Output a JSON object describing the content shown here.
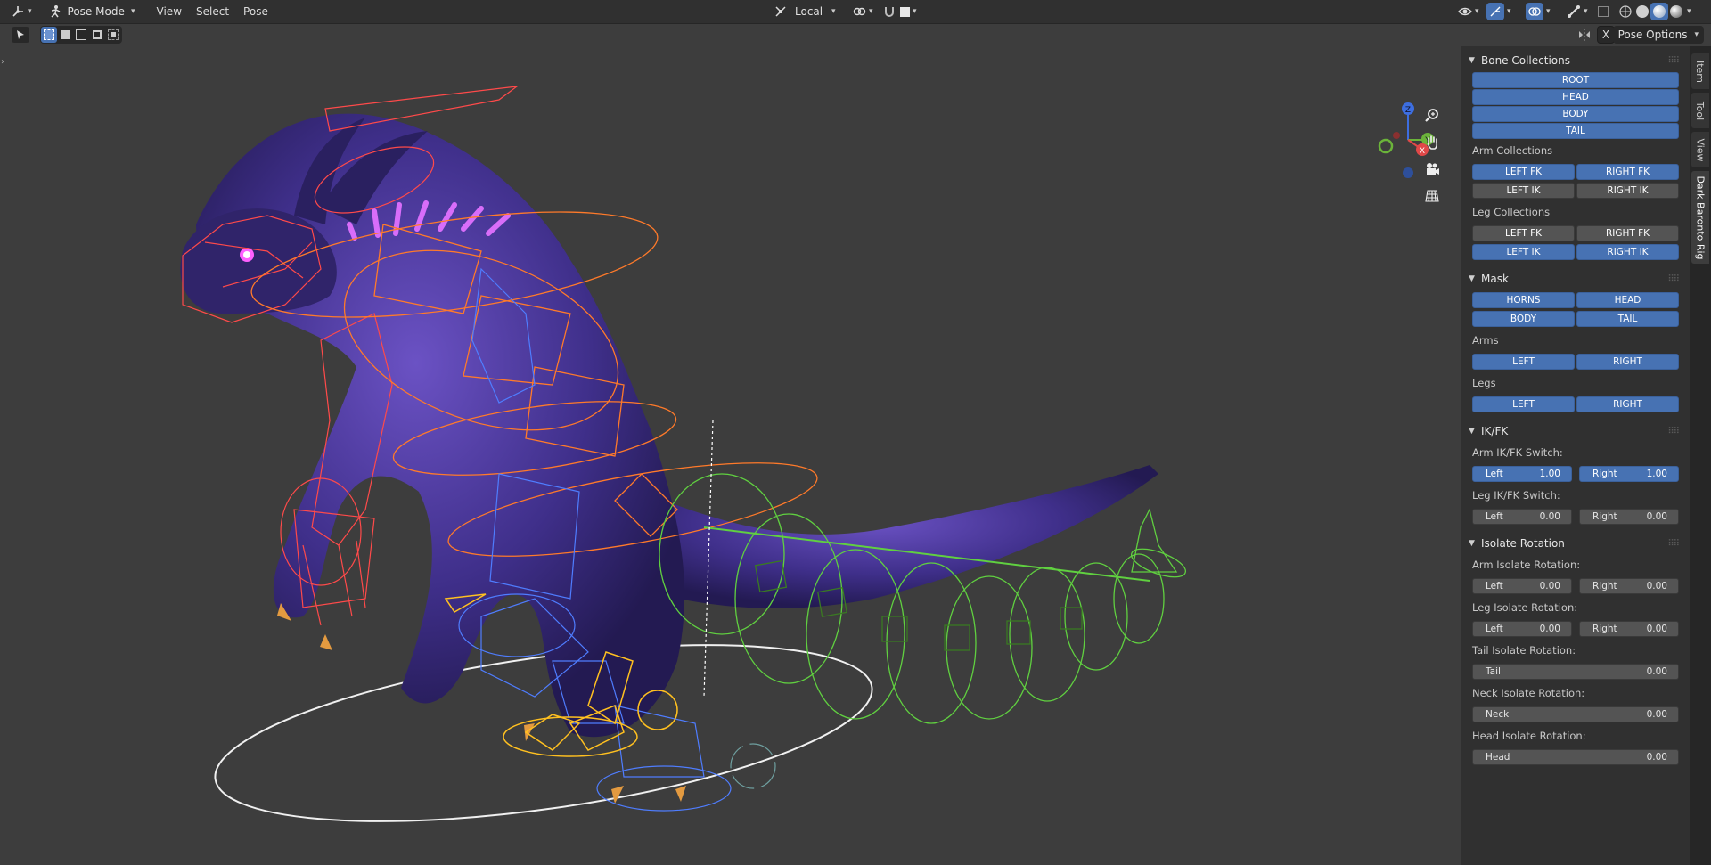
{
  "header": {
    "mode": "Pose Mode",
    "menus": [
      "View",
      "Select",
      "Pose"
    ],
    "orientation": "Local"
  },
  "tool_header": {
    "options_label": "Pose Options",
    "mirror_label": "X"
  },
  "tabs": [
    "Item",
    "Tool",
    "View",
    "Dark Baronto Rig"
  ],
  "sidebar": {
    "bone_collections": {
      "title": "Bone Collections",
      "main": [
        "ROOT",
        "HEAD",
        "BODY",
        "TAIL"
      ],
      "arm_label": "Arm Collections",
      "arm": {
        "left_fk": "LEFT FK",
        "right_fk": "RIGHT FK",
        "left_ik": "LEFT IK",
        "right_ik": "RIGHT IK"
      },
      "leg_label": "Leg Collections",
      "leg": {
        "left_fk": "LEFT FK",
        "right_fk": "RIGHT FK",
        "left_ik": "LEFT IK",
        "right_ik": "RIGHT IK"
      }
    },
    "mask": {
      "title": "Mask",
      "horns": "HORNS",
      "head": "HEAD",
      "body": "BODY",
      "tail": "TAIL",
      "arms_label": "Arms",
      "arms_left": "LEFT",
      "arms_right": "RIGHT",
      "legs_label": "Legs",
      "legs_left": "LEFT",
      "legs_right": "RIGHT"
    },
    "ikfk": {
      "title": "IK/FK",
      "arm_label": "Arm IK/FK Switch:",
      "arm_left": {
        "label": "Left",
        "value": "1.00"
      },
      "arm_right": {
        "label": "Right",
        "value": "1.00"
      },
      "leg_label": "Leg IK/FK Switch:",
      "leg_left": {
        "label": "Left",
        "value": "0.00"
      },
      "leg_right": {
        "label": "Right",
        "value": "0.00"
      }
    },
    "isolate": {
      "title": "Isolate Rotation",
      "arm_label": "Arm Isolate Rotation:",
      "arm_left": {
        "label": "Left",
        "value": "0.00"
      },
      "arm_right": {
        "label": "Right",
        "value": "0.00"
      },
      "leg_label": "Leg Isolate Rotation:",
      "leg_left": {
        "label": "Left",
        "value": "0.00"
      },
      "leg_right": {
        "label": "Right",
        "value": "0.00"
      },
      "tail_label": "Tail Isolate Rotation:",
      "tail": {
        "label": "Tail",
        "value": "0.00"
      },
      "neck_label": "Neck Isolate Rotation:",
      "neck": {
        "label": "Neck",
        "value": "0.00"
      },
      "head_label": "Head Isolate Rotation:",
      "head": {
        "label": "Head",
        "value": "0.00"
      }
    }
  },
  "gizmo": {
    "z": "Z",
    "y": "Y",
    "x": "X"
  },
  "colors": {
    "accent": "#4772b3",
    "bg": "#3d3d3d",
    "panel": "#303030"
  }
}
